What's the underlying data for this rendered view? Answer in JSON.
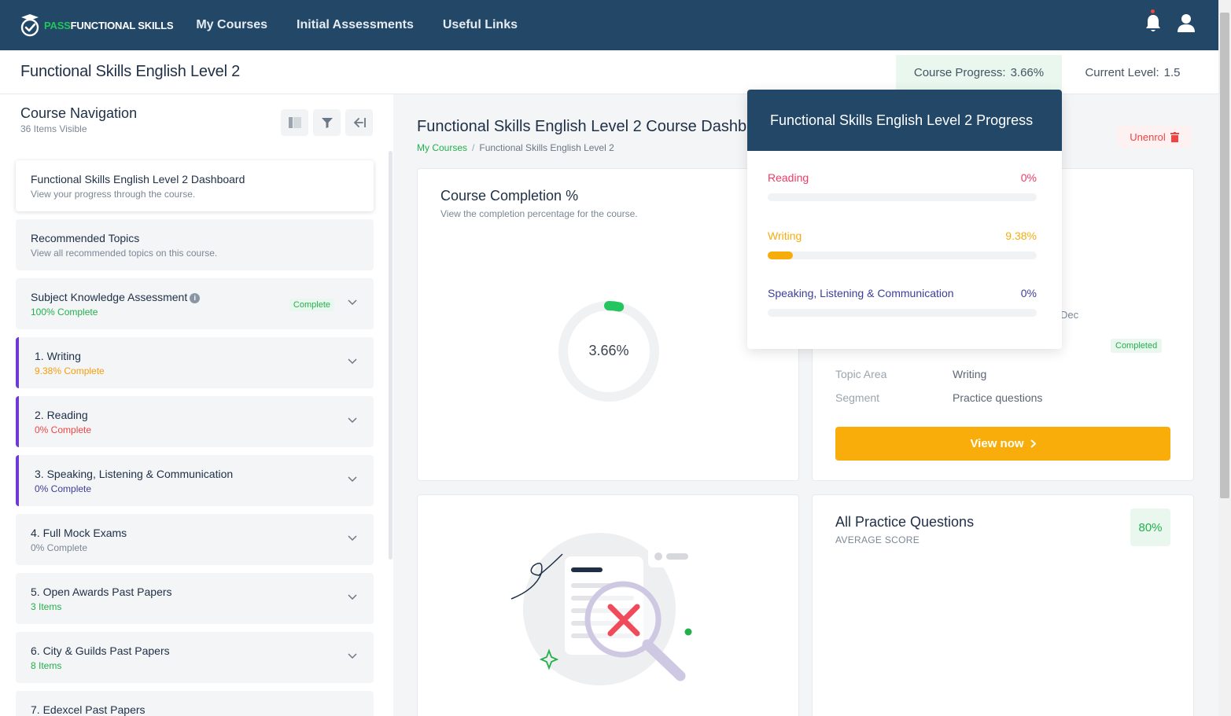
{
  "brand": {
    "logo_pass": "PASS",
    "logo_rest": "FUNCTIONAL SKILLS"
  },
  "nav": {
    "links": [
      "My Courses",
      "Initial Assessments",
      "Useful Links"
    ]
  },
  "header": {
    "title": "Functional Skills English Level 2",
    "progress_label": "Course Progress:",
    "progress_value": "3.66%",
    "level_label": "Current Level:",
    "level_value": "1.5"
  },
  "sidebar": {
    "title": "Course Navigation",
    "subtitle": "36 Items Visible",
    "items": [
      {
        "title": "Functional Skills English Level 2 Dashboard",
        "sub": "View your progress through the course."
      },
      {
        "title": "Recommended Topics",
        "sub": "View all recommended topics on this course."
      },
      {
        "title": "Subject Knowledge Assessment",
        "sub": "100% Complete",
        "badge": "Complete"
      },
      {
        "title": "1. Writing",
        "sub": "9.38% Complete"
      },
      {
        "title": "2. Reading",
        "sub": "0% Complete"
      },
      {
        "title": "3. Speaking, Listening & Communication",
        "sub": "0% Complete"
      },
      {
        "title": "4. Full Mock Exams",
        "sub": "0% Complete"
      },
      {
        "title": "5. Open Awards Past Papers",
        "sub": "3 Items"
      },
      {
        "title": "6. City & Guilds Past Papers",
        "sub": "8 Items"
      },
      {
        "title": "7. Edexcel Past Papers",
        "sub": ""
      }
    ]
  },
  "main": {
    "title": "Functional Skills English Level 2 Course Dashboard",
    "breadcrumb": [
      "My Courses",
      "Functional Skills English Level 2"
    ],
    "unenrol": "Unenrol",
    "completion": {
      "title": "Course Completion %",
      "subtitle": "View the completion percentage for the course.",
      "value": "3.66%",
      "fraction": 0.0366
    },
    "topic": {
      "partial": "Dec",
      "badge": "Completed",
      "rows": [
        {
          "key": "Topic Area",
          "value": "Writing"
        },
        {
          "key": "Segment",
          "value": "Practice questions"
        }
      ],
      "button": "View now"
    },
    "practice": {
      "title": "All Practice Questions",
      "subtitle": "AVERAGE SCORE",
      "score": "80%"
    }
  },
  "popover": {
    "title": "Functional Skills English Level 2 Progress",
    "rows": [
      {
        "label": "Reading",
        "value": "0%",
        "fraction": 0,
        "color": "#ef3a66"
      },
      {
        "label": "Writing",
        "value": "9.38%",
        "fraction": 0.0938,
        "color": "#f6ad0c"
      },
      {
        "label": "Speaking, Listening & Communication",
        "value": "0%",
        "fraction": 0,
        "color": "#3d3d9a"
      }
    ]
  },
  "colors": {
    "nav": "#234766",
    "accent_green": "#22b04b",
    "accent_orange": "#f8ad0a",
    "accent_purple": "#6d3ad6"
  }
}
